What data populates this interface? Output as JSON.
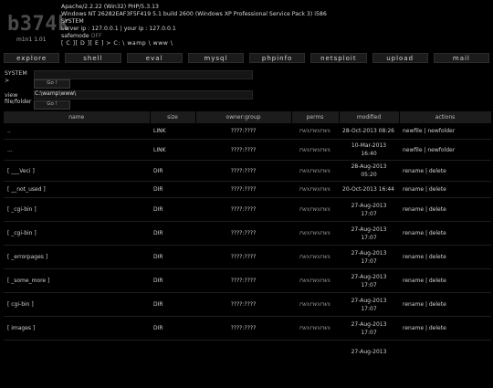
{
  "logo": {
    "text": "b374k",
    "version": "m1n1 1.01"
  },
  "server": {
    "line1": "Apache/2.2.22 (Win32) PHP/5.3.13",
    "line2": "Windows NT 26282EAF3F5F419 5.1 build 2600 (Windows XP Professional Service Pack 3) i586",
    "line3": "SYSTEM",
    "line4": "server ip : 127.0.0.1 | your ip : 127.0.0.1",
    "safemode_label": "safemode",
    "safemode_value": "OFF",
    "drives": [
      "[ C ]",
      "[ D ]",
      "[ E ]"
    ],
    "path": "> C: \\ wamp \\ www \\"
  },
  "menu": [
    "explore",
    "shell",
    "eval",
    "mysql",
    "phpinfo",
    "netsploit",
    "upload",
    "mail"
  ],
  "shell": {
    "label1": "SYSTEM",
    "label2": ">",
    "go": "Go !"
  },
  "view": {
    "label1": "view",
    "label2": "file/folder",
    "value": "C:\\wamp\\www\\",
    "go": "Go !"
  },
  "table": {
    "headers": [
      "name",
      "size",
      "owner:group",
      "perms",
      "modified",
      "actions"
    ],
    "rows": [
      {
        "name": "..",
        "size": "LINK",
        "owner": "????:????",
        "perms": "rwxrwxrwx",
        "mod1": "28-Oct-2013 08:26",
        "mod2": "",
        "actions": "newfile | newfolder"
      },
      {
        "name": "...",
        "size": "LINK",
        "owner": "????:????",
        "perms": "rwxrwxrwx",
        "mod1": "10-Mar-2013",
        "mod2": "16:40",
        "actions": "newfile | newfolder"
      },
      {
        "name": "[ ___Veci ]",
        "size": "DIR",
        "owner": "????:????",
        "perms": "rwxrwxrwx",
        "mod1": "28-Aug-2013",
        "mod2": "05:20",
        "actions": "rename | delete"
      },
      {
        "name": "[ __not_used ]",
        "size": "DIR",
        "owner": "????:????",
        "perms": "rwxrwxrwx",
        "mod1": "20-Oct-2013 16:44",
        "mod2": "",
        "actions": "rename | delete"
      },
      {
        "name": "[ _cgi-bin ]",
        "size": "DIR",
        "owner": "????:????",
        "perms": "rwxrwxrwx",
        "mod1": "27-Aug-2013",
        "mod2": "17:07",
        "actions": "rename | delete"
      },
      {
        "name": "[ _cgi-bin ]",
        "size": "DIR",
        "owner": "????:????",
        "perms": "rwxrwxrwx",
        "mod1": "27-Aug-2013",
        "mod2": "17:07",
        "actions": "rename | delete"
      },
      {
        "name": "[ _errorpages ]",
        "size": "DIR",
        "owner": "????:????",
        "perms": "rwxrwxrwx",
        "mod1": "27-Aug-2013",
        "mod2": "17:07",
        "actions": "rename | delete"
      },
      {
        "name": "[ _some_more ]",
        "size": "DIR",
        "owner": "????:????",
        "perms": "rwxrwxrwx",
        "mod1": "27-Aug-2013",
        "mod2": "17:07",
        "actions": "rename | delete"
      },
      {
        "name": "[ cgi-bin ]",
        "size": "DIR",
        "owner": "????:????",
        "perms": "rwxrwxrwx",
        "mod1": "27-Aug-2013",
        "mod2": "17:07",
        "actions": "rename | delete"
      },
      {
        "name": "[ images ]",
        "size": "DIR",
        "owner": "????:????",
        "perms": "rwxrwxrwx",
        "mod1": "27-Aug-2013",
        "mod2": "17:07",
        "actions": "rename | delete"
      },
      {
        "name": "",
        "size": "",
        "owner": "",
        "perms": "",
        "mod1": "27-Aug-2013",
        "mod2": "",
        "actions": ""
      }
    ]
  }
}
